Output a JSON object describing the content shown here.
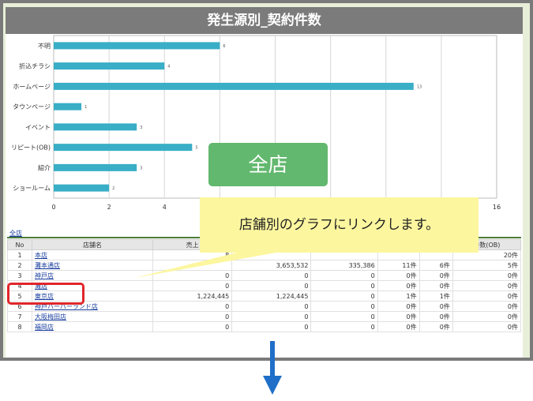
{
  "title": "発生源別_契約件数",
  "overlay_label": "全店",
  "tooltip": "店舗別のグラフにリンクします。",
  "table": {
    "link_label": "全店",
    "headers": [
      "No",
      "店舗名",
      "売上",
      "",
      "",
      "",
      "",
      "件数(OB)"
    ],
    "rows": [
      {
        "no": "1",
        "name": "本店",
        "c1": "8",
        "c2": "",
        "c3": "",
        "c4": "",
        "c5": "",
        "c6": "20件"
      },
      {
        "no": "2",
        "name": "灘本通店",
        "c1": "",
        "c2": "3,653,532",
        "c3": "335,386",
        "c4": "11件",
        "c5": "6件",
        "c6": "5件"
      },
      {
        "no": "3",
        "name": "神戸店",
        "c1": "0",
        "c2": "0",
        "c3": "0",
        "c4": "0件",
        "c5": "0件",
        "c6": "0件"
      },
      {
        "no": "4",
        "name": "灘店",
        "c1": "0",
        "c2": "0",
        "c3": "0",
        "c4": "0件",
        "c5": "0件",
        "c6": "0件"
      },
      {
        "no": "5",
        "name": "東京店",
        "c1": "1,224,445",
        "c2": "1,224,445",
        "c3": "0",
        "c4": "1件",
        "c5": "1件",
        "c6": "0件"
      },
      {
        "no": "6",
        "name": "神戸ハーバーランド店",
        "c1": "0",
        "c2": "0",
        "c3": "0",
        "c4": "0件",
        "c5": "0件",
        "c6": "0件"
      },
      {
        "no": "7",
        "name": "大阪梅田店",
        "c1": "0",
        "c2": "0",
        "c3": "0",
        "c4": "0件",
        "c5": "0件",
        "c6": "0件"
      },
      {
        "no": "8",
        "name": "福岡店",
        "c1": "0",
        "c2": "0",
        "c3": "0",
        "c4": "0件",
        "c5": "0件",
        "c6": "0件"
      }
    ]
  },
  "chart_data": {
    "type": "bar",
    "orientation": "horizontal",
    "categories": [
      "不明",
      "折込チラシ",
      "ホームページ",
      "タウンページ",
      "イベント",
      "リピート(OB)",
      "紹介",
      "ショールーム"
    ],
    "values": [
      6,
      4,
      13,
      1,
      3,
      5,
      3,
      2
    ],
    "xticks": [
      "0",
      "2",
      "4",
      "16"
    ],
    "xlim": [
      0,
      16
    ],
    "bar_color": "#39aec6",
    "grid": true
  },
  "colors": {
    "overlay": "#62b86e",
    "tooltip": "#fcf69f",
    "highlight": "#e0262b",
    "arrow": "#1f6fc8"
  }
}
